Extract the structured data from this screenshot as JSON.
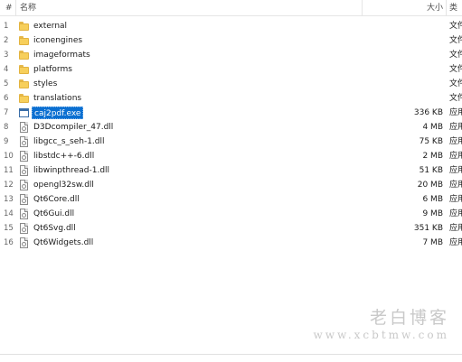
{
  "header": {
    "num_label": "#",
    "name_label": "名称",
    "size_label": "大小",
    "type_label": "类"
  },
  "rows": [
    {
      "num": "1",
      "name": "external",
      "size": "",
      "type": "文件",
      "icon": "folder-icon",
      "selected": false
    },
    {
      "num": "2",
      "name": "iconengines",
      "size": "",
      "type": "文件",
      "icon": "folder-icon",
      "selected": false
    },
    {
      "num": "3",
      "name": "imageformats",
      "size": "",
      "type": "文件",
      "icon": "folder-icon",
      "selected": false
    },
    {
      "num": "4",
      "name": "platforms",
      "size": "",
      "type": "文件",
      "icon": "folder-icon",
      "selected": false
    },
    {
      "num": "5",
      "name": "styles",
      "size": "",
      "type": "文件",
      "icon": "folder-icon",
      "selected": false
    },
    {
      "num": "6",
      "name": "translations",
      "size": "",
      "type": "文件",
      "icon": "folder-icon",
      "selected": false
    },
    {
      "num": "7",
      "name": "caj2pdf.exe",
      "size": "336 KB",
      "type": "应用",
      "icon": "exe-icon",
      "selected": true
    },
    {
      "num": "8",
      "name": "D3Dcompiler_47.dll",
      "size": "4 MB",
      "type": "应用",
      "icon": "dll-file-icon",
      "selected": false
    },
    {
      "num": "9",
      "name": "libgcc_s_seh-1.dll",
      "size": "75 KB",
      "type": "应用",
      "icon": "dll-file-icon",
      "selected": false
    },
    {
      "num": "10",
      "name": "libstdc++-6.dll",
      "size": "2 MB",
      "type": "应用",
      "icon": "dll-file-icon",
      "selected": false
    },
    {
      "num": "11",
      "name": "libwinpthread-1.dll",
      "size": "51 KB",
      "type": "应用",
      "icon": "dll-file-icon",
      "selected": false
    },
    {
      "num": "12",
      "name": "opengl32sw.dll",
      "size": "20 MB",
      "type": "应用",
      "icon": "dll-file-icon",
      "selected": false
    },
    {
      "num": "13",
      "name": "Qt6Core.dll",
      "size": "6 MB",
      "type": "应用",
      "icon": "dll-file-icon",
      "selected": false
    },
    {
      "num": "14",
      "name": "Qt6Gui.dll",
      "size": "9 MB",
      "type": "应用",
      "icon": "dll-file-icon",
      "selected": false
    },
    {
      "num": "15",
      "name": "Qt6Svg.dll",
      "size": "351 KB",
      "type": "应用",
      "icon": "dll-file-icon",
      "selected": false
    },
    {
      "num": "16",
      "name": "Qt6Widgets.dll",
      "size": "7 MB",
      "type": "应用",
      "icon": "dll-file-icon",
      "selected": false
    }
  ],
  "watermark": {
    "title": "老白博客",
    "url": "www.xcbtmw.com"
  }
}
